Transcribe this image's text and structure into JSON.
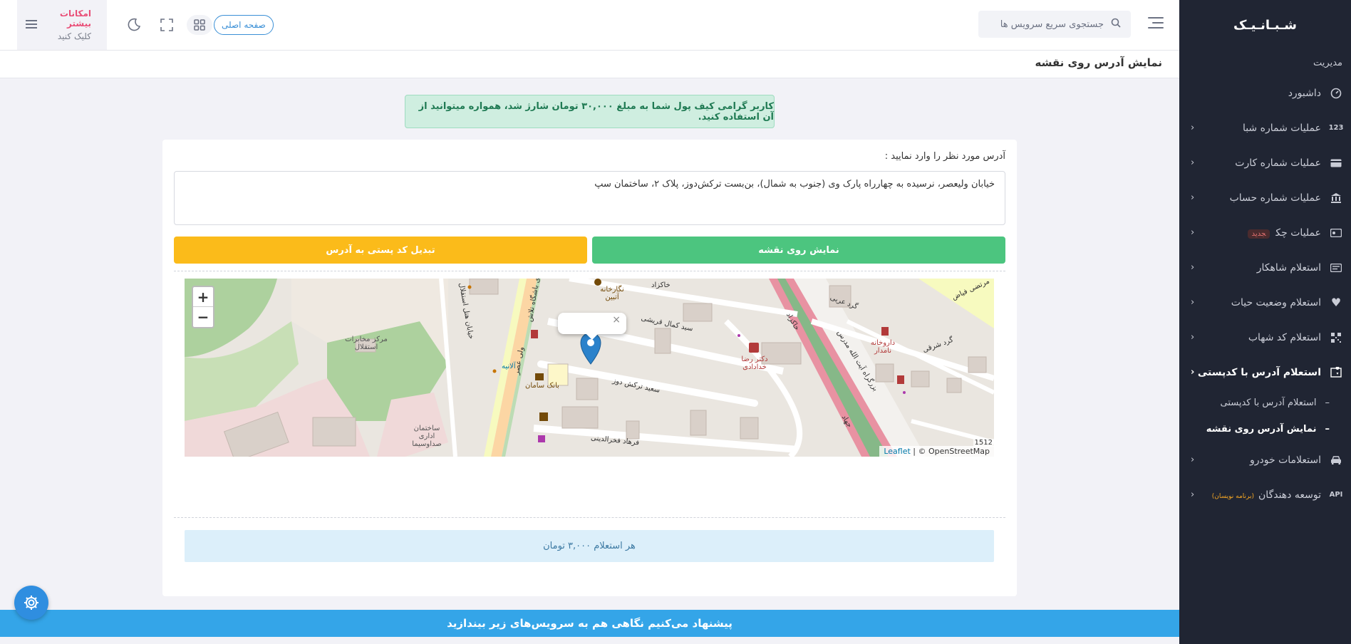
{
  "sidebar": {
    "logo": "شـبـانـیـک",
    "section": "مدیریت",
    "items": [
      {
        "label": "داشبورد",
        "icon": "dashboard-gauge-icon",
        "icon_text": ""
      },
      {
        "label": "عملیات شماره شبا",
        "icon": "number-123-icon",
        "icon_text": "123"
      },
      {
        "label": "عملیات شماره کارت",
        "icon": "credit-card-icon",
        "icon_text": ""
      },
      {
        "label": "عملیات شماره حساب",
        "icon": "bank-icon",
        "icon_text": ""
      },
      {
        "label": "عملیات چک",
        "icon": "cheque-icon",
        "icon_text": "",
        "badge": "جدید"
      },
      {
        "label": "استعلام شاهکار",
        "icon": "id-card-icon",
        "icon_text": ""
      },
      {
        "label": "استعلام وضعیت حیات",
        "icon": "heart-icon",
        "icon_text": ""
      },
      {
        "label": "استعلام کد شهاب",
        "icon": "qr-code-icon",
        "icon_text": ""
      },
      {
        "label": "استعلام آدرس با کدپستی",
        "icon": "map-pin-icon",
        "icon_text": "",
        "active": true
      },
      {
        "label": "استعلامات خودرو",
        "icon": "car-icon",
        "icon_text": ""
      },
      {
        "label": "توسعه دهندگان",
        "icon": "api-icon",
        "icon_text": "API",
        "badge": "(برنامه نویسان)"
      }
    ],
    "sub_items": [
      {
        "label": "استعلام آدرس با کدپستی"
      },
      {
        "label": "نمایش آدرس روی نقشه",
        "active": true
      }
    ]
  },
  "header": {
    "search_placeholder": "جستجوی سریع سرویس ها",
    "home_label": "صفحه اصلی",
    "more_title": "امکانات بیشتر",
    "more_sub": "کلیک کنید"
  },
  "page": {
    "title": "نمایش آدرس روی نقشه",
    "alert": "کاربر گرامی کیف پول شما به مبلغ ۳۰,۰۰۰ تومان شارژ شد، همواره میتوانید از آن استفاده کنید.",
    "field_label": "آدرس مورد نظر را وارد نمایید :",
    "address_value": "خیابان ولیعصر، نرسیده به چهارراه پارک وی (جنوب به شمال)، بن‌بست ترکش‌دوز، پلاک ۲، ساختمان سپ",
    "btn_map": "نمایش روی نقشه",
    "btn_postal": "تبدیل کد پستی به آدرس",
    "price": "هر استعلام ۳,۰۰۰ تومان",
    "banner": "پیشنهاد می‌کنیم نگاهی هم به سرویس‌های زیر بیندازید"
  },
  "map": {
    "zoom_in": "+",
    "zoom_out": "−",
    "popup_close": "×",
    "attribution_leaflet": "Leaflet",
    "attribution_osm": " | © OpenStreetMap",
    "scale": "1512",
    "labels": {
      "l1": "خاکزاد",
      "l2": "نگارخانه آتبین",
      "l3": "سید کمال قریشی",
      "l4": "دکتر رضا خدادادی",
      "l5": "داروخانه نامدار",
      "l6": "گرد عربی",
      "l7": "گرد شرقی",
      "l8": "بزرگراه آیت الله مدرس",
      "l9": "مرتضی فیاض",
      "l10": "سعید ترکش دوز",
      "l11": "فرهاد فخرالدینی",
      "l12": "بانک سامان",
      "l13": "ولی عصر",
      "l14": "مرکز مخابرات استقلال",
      "l15": "ساختمان اداری صداوسیما",
      "l16": "خیابان هتل استقلال",
      "l17": "تری باشگاه تلاش",
      "l18": "آلانیه",
      "l19": "جهاد",
      "l20": "خاکزاد"
    }
  },
  "colors": {
    "sidebar_bg": "#202533",
    "alert_bg": "#cfeee0",
    "btn_green": "#4cc57f",
    "btn_yellow": "#fbbb1a",
    "banner": "#34a5e8",
    "marker": "#2b82cb"
  }
}
